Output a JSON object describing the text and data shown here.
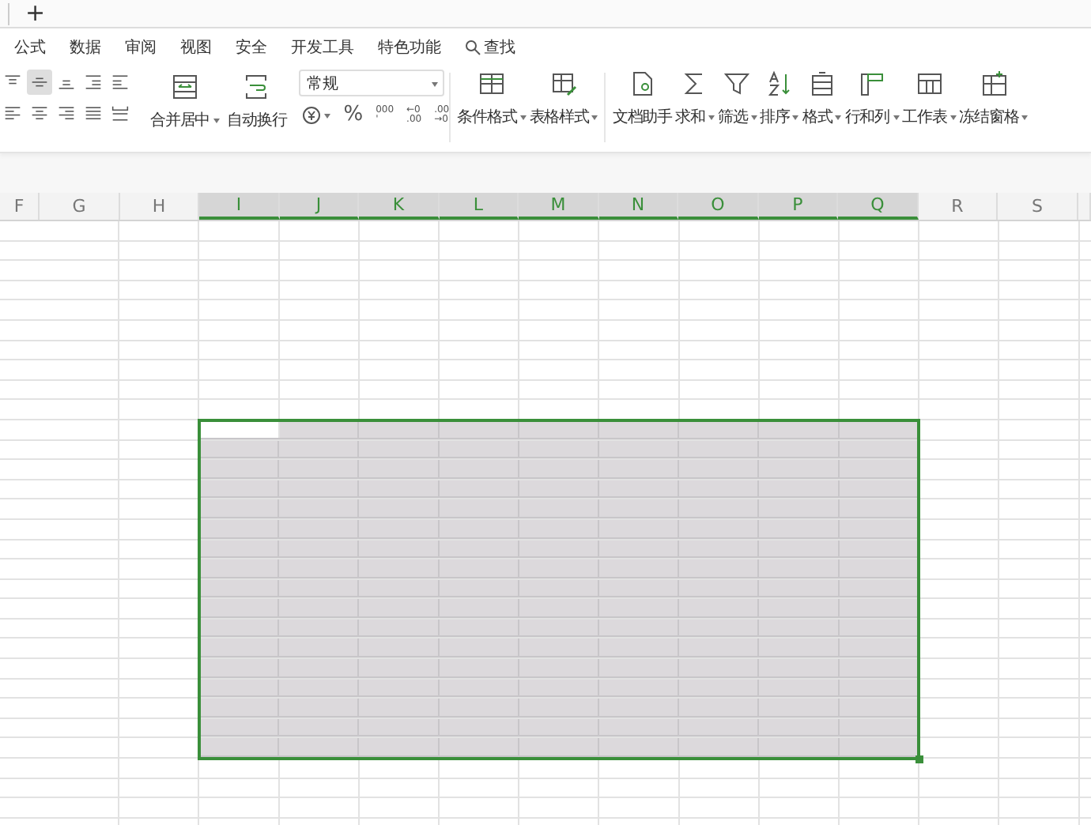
{
  "tab_bar": {
    "new_tab": "+"
  },
  "menu": [
    {
      "label": "公式",
      "kind": "text"
    },
    {
      "label": "数据",
      "kind": "text"
    },
    {
      "label": "审阅",
      "kind": "text"
    },
    {
      "label": "视图",
      "kind": "text"
    },
    {
      "label": "安全",
      "kind": "text"
    },
    {
      "label": "开发工具",
      "kind": "text"
    },
    {
      "label": "特色功能",
      "kind": "text"
    },
    {
      "label": "查找",
      "kind": "search"
    }
  ],
  "align_buttons": [
    {
      "kind": "top",
      "selected": false
    },
    {
      "kind": "middle",
      "selected": true
    },
    {
      "kind": "bottom",
      "selected": false
    },
    {
      "kind": "outdent",
      "selected": false
    },
    {
      "kind": "indent",
      "selected": false
    },
    {
      "kind": "left",
      "selected": false
    },
    {
      "kind": "center",
      "selected": false
    },
    {
      "kind": "right",
      "selected": false
    },
    {
      "kind": "justify",
      "selected": false
    },
    {
      "kind": "distributed",
      "selected": false
    }
  ],
  "merge_buttons": [
    {
      "label": "合并居中",
      "kind": "merge",
      "dropdown": true
    },
    {
      "label": "自动换行",
      "kind": "wrap",
      "dropdown": false
    }
  ],
  "number_format": {
    "value": "常规",
    "buttons": [
      {
        "kind": "currency",
        "dropdown": true
      },
      {
        "kind": "text",
        "label": "%"
      },
      {
        "kind": "stack",
        "label": "000",
        "sub": "'"
      },
      {
        "kind": "stack",
        "label": "←0",
        "sub": ".00"
      },
      {
        "kind": "stack",
        "label": ".00",
        "sub": "→0"
      }
    ]
  },
  "tools": [
    {
      "label": "条件格式",
      "kind": "cond",
      "dropdown": true,
      "divider": false
    },
    {
      "label": "表格样式",
      "kind": "tablestyle",
      "dropdown": true,
      "divider": true
    },
    {
      "label": "文档助手",
      "kind": "doc",
      "dropdown": false,
      "divider": false
    },
    {
      "label": "求和",
      "kind": "sum",
      "dropdown": true,
      "divider": false
    },
    {
      "label": "筛选",
      "kind": "filter",
      "dropdown": true,
      "divider": false
    },
    {
      "label": "排序",
      "kind": "sort",
      "dropdown": true,
      "divider": false
    },
    {
      "label": "格式",
      "kind": "format",
      "dropdown": true,
      "divider": false
    },
    {
      "label": "行和列",
      "kind": "rowcol",
      "dropdown": true,
      "divider": false
    },
    {
      "label": "工作表",
      "kind": "sheet",
      "dropdown": true,
      "divider": false
    },
    {
      "label": "冻结窗格",
      "kind": "freeze",
      "dropdown": true,
      "divider": false
    }
  ],
  "columns": [
    {
      "label": "F",
      "selected": false
    },
    {
      "label": "G",
      "selected": false
    },
    {
      "label": "H",
      "selected": false
    },
    {
      "label": "I",
      "selected": true
    },
    {
      "label": "J",
      "selected": true
    },
    {
      "label": "K",
      "selected": true
    },
    {
      "label": "L",
      "selected": true
    },
    {
      "label": "M",
      "selected": true
    },
    {
      "label": "N",
      "selected": true
    },
    {
      "label": "O",
      "selected": true
    },
    {
      "label": "P",
      "selected": true
    },
    {
      "label": "Q",
      "selected": true
    },
    {
      "label": "R",
      "selected": false
    },
    {
      "label": "S",
      "selected": false
    }
  ],
  "rows": [
    {
      "selected": false
    },
    {
      "selected": false
    },
    {
      "selected": false
    },
    {
      "selected": false
    },
    {
      "selected": false
    },
    {
      "selected": false
    },
    {
      "selected": false
    },
    {
      "selected": false
    },
    {
      "selected": false
    },
    {
      "selected": false
    },
    {
      "selected": true
    },
    {
      "selected": true
    },
    {
      "selected": true
    },
    {
      "selected": true
    },
    {
      "selected": true
    },
    {
      "selected": true
    },
    {
      "selected": true
    },
    {
      "selected": true
    },
    {
      "selected": true
    },
    {
      "selected": true
    },
    {
      "selected": true
    },
    {
      "selected": true
    },
    {
      "selected": true
    },
    {
      "selected": true
    },
    {
      "selected": true
    },
    {
      "selected": true
    },
    {
      "selected": true
    },
    {
      "selected": false
    },
    {
      "selected": false
    },
    {
      "selected": false
    },
    {
      "selected": false
    }
  ]
}
